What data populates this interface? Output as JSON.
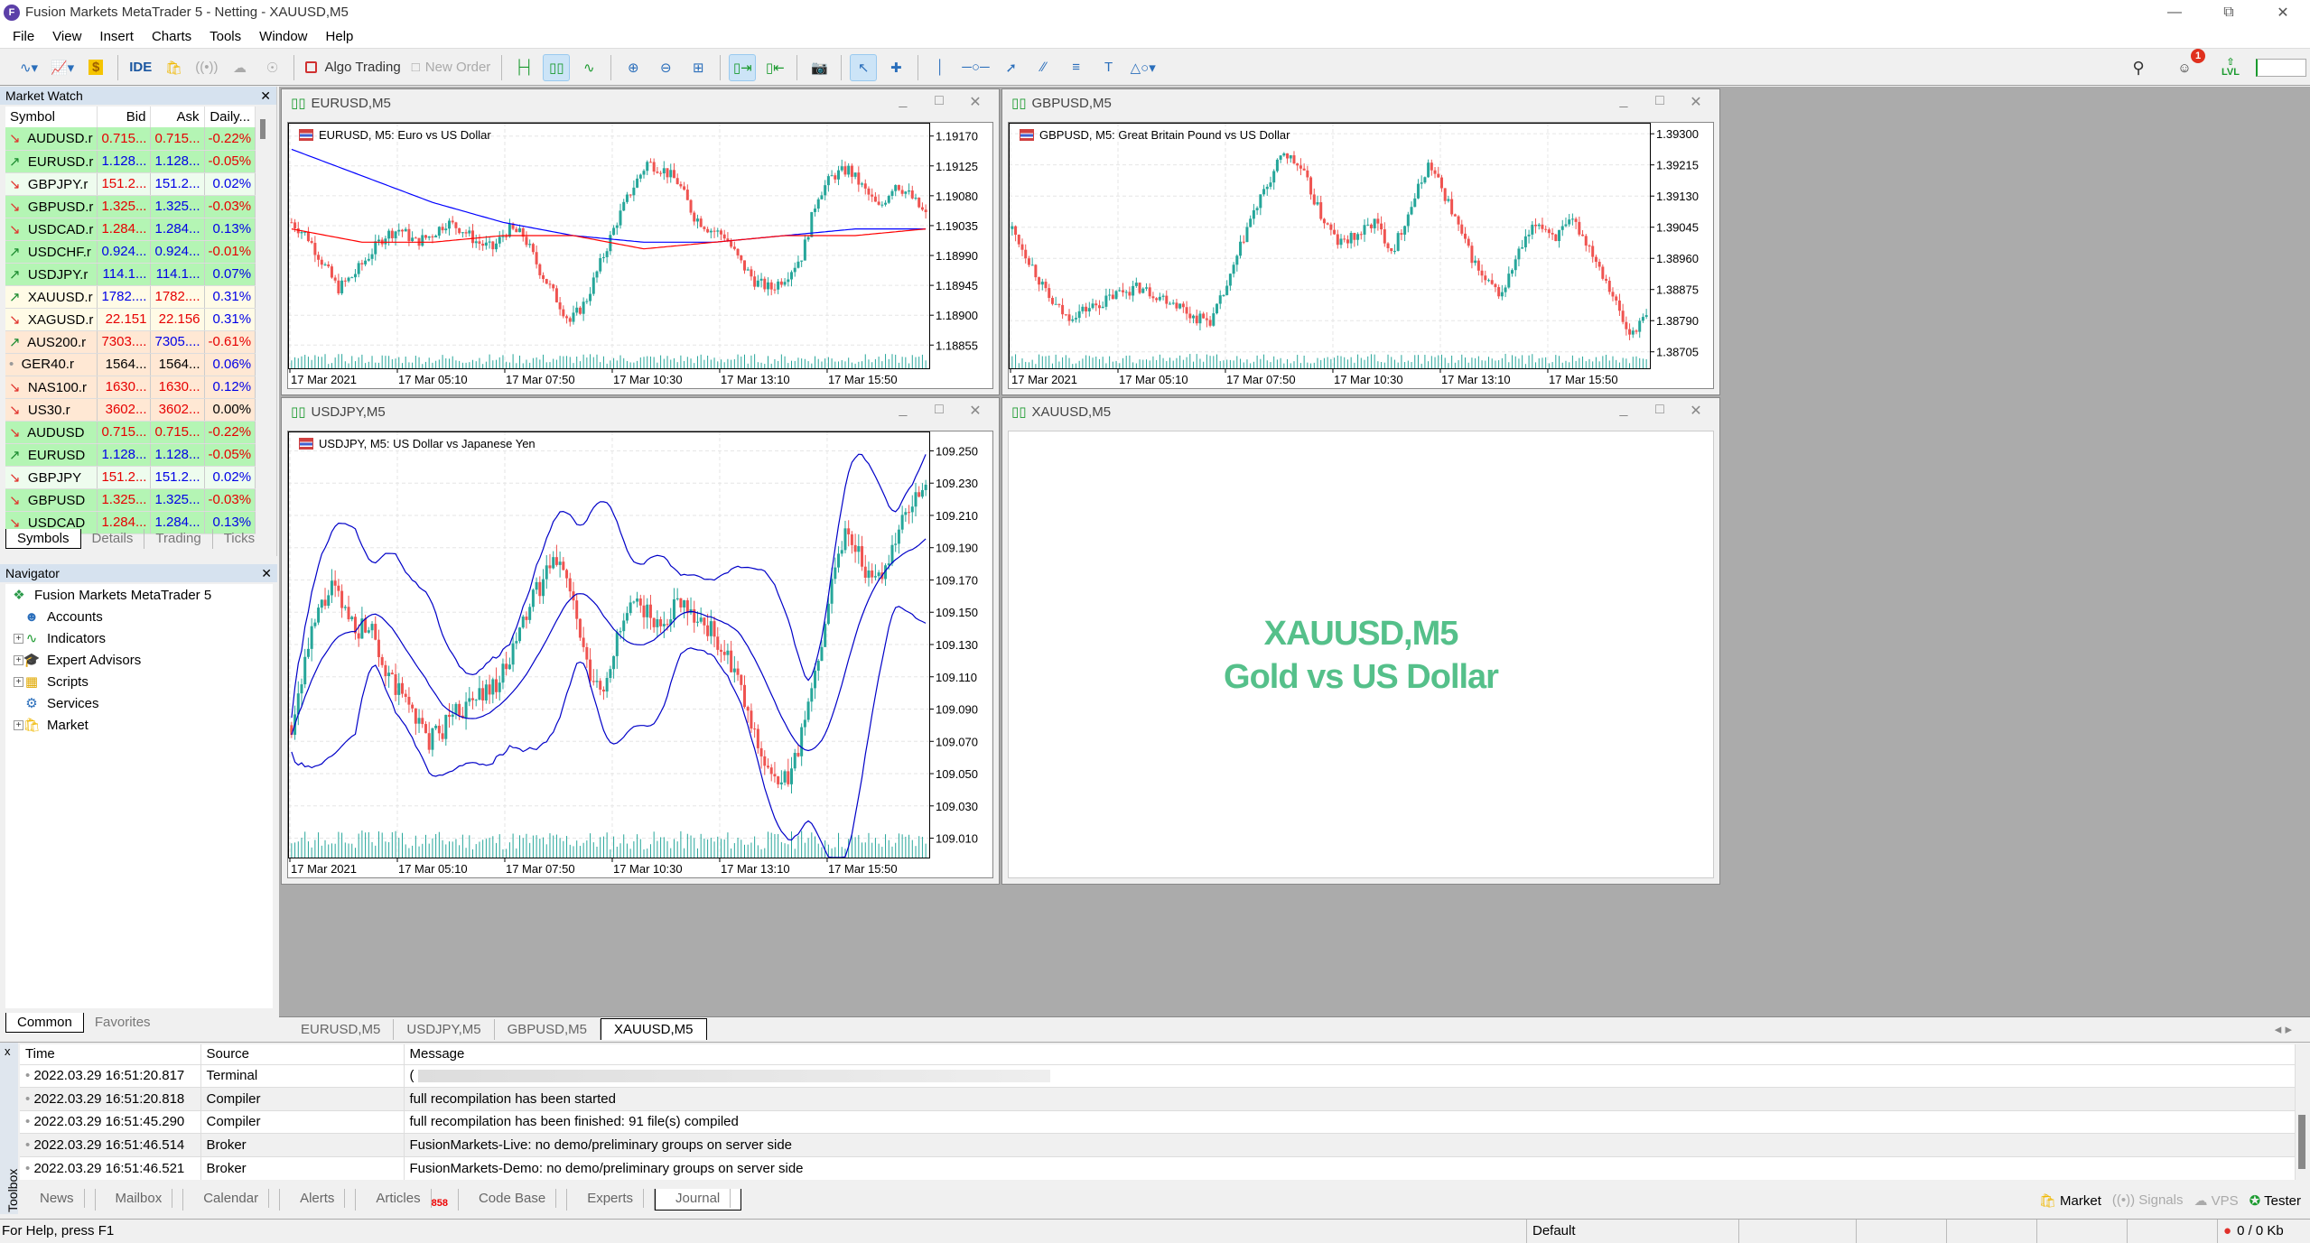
{
  "window": {
    "title": "Fusion Markets MetaTrader 5 - Netting - XAUUSD,M5",
    "controls": [
      "minimize",
      "restore",
      "close"
    ]
  },
  "menu": [
    "File",
    "View",
    "Insert",
    "Charts",
    "Tools",
    "Window",
    "Help"
  ],
  "toolbar": {
    "ide_label": "IDE",
    "algo_trading_label": "Algo Trading",
    "new_order_label": "New Order",
    "notification_count": "1",
    "level_label": "LVL",
    "icons": [
      "new-chart-icon",
      "profiles-icon",
      "dollar-icon",
      "ide-icon",
      "market-icon",
      "signals-icon",
      "vps-icon",
      "tester-icon",
      "algo-trading-icon",
      "new-order-icon",
      "bar-chart-icon",
      "candlestick-icon",
      "line-chart-icon",
      "zoom-in-icon",
      "zoom-out-icon",
      "tile-icon",
      "autoscroll-icon",
      "chart-shift-icon",
      "screenshot-icon",
      "cursor-icon",
      "crosshair-icon",
      "vertical-line-icon",
      "horizontal-line-icon",
      "trendline-icon",
      "equidistant-channel-icon",
      "fibonacci-icon",
      "text-icon",
      "shapes-icon",
      "search-icon",
      "account-icon",
      "level-icon"
    ]
  },
  "market_watch": {
    "title": "Market Watch",
    "columns": [
      "Symbol",
      "Bid",
      "Ask",
      "Daily..."
    ],
    "rows": [
      {
        "dir": "down",
        "symbol": "AUDUSD.r",
        "bid": "0.715...",
        "ask": "0.715...",
        "daily": "-0.22%",
        "bid_c": "red",
        "ask_c": "red",
        "daily_c": "red",
        "bg": "#b4f5b4"
      },
      {
        "dir": "up",
        "symbol": "EURUSD.r",
        "bid": "1.128...",
        "ask": "1.128...",
        "daily": "-0.05%",
        "bid_c": "blue",
        "ask_c": "blue",
        "daily_c": "red",
        "bg": "#b4f5b4"
      },
      {
        "dir": "down",
        "symbol": "GBPJPY.r",
        "bid": "151.2...",
        "ask": "151.2...",
        "daily": "0.02%",
        "bid_c": "red",
        "ask_c": "blue",
        "daily_c": "blue",
        "bg": "#eefcee"
      },
      {
        "dir": "down",
        "symbol": "GBPUSD.r",
        "bid": "1.325...",
        "ask": "1.325...",
        "daily": "-0.03%",
        "bid_c": "red",
        "ask_c": "blue",
        "daily_c": "red",
        "bg": "#b4f5b4"
      },
      {
        "dir": "down",
        "symbol": "USDCAD.r",
        "bid": "1.284...",
        "ask": "1.284...",
        "daily": "0.13%",
        "bid_c": "red",
        "ask_c": "blue",
        "daily_c": "blue",
        "bg": "#b4f5b4"
      },
      {
        "dir": "up",
        "symbol": "USDCHF.r",
        "bid": "0.924...",
        "ask": "0.924...",
        "daily": "-0.01%",
        "bid_c": "blue",
        "ask_c": "blue",
        "daily_c": "red",
        "bg": "#b4f5b4"
      },
      {
        "dir": "up",
        "symbol": "USDJPY.r",
        "bid": "114.1...",
        "ask": "114.1...",
        "daily": "0.07%",
        "bid_c": "blue",
        "ask_c": "blue",
        "daily_c": "blue",
        "bg": "#b4f5b4"
      },
      {
        "dir": "up",
        "symbol": "XAUUSD.r",
        "bid": "1782....",
        "ask": "1782....",
        "daily": "0.31%",
        "bid_c": "blue",
        "ask_c": "red",
        "daily_c": "blue",
        "bg": "#fffbe6"
      },
      {
        "dir": "down",
        "symbol": "XAGUSD.r",
        "bid": "22.151",
        "ask": "22.156",
        "daily": "0.31%",
        "bid_c": "red",
        "ask_c": "red",
        "daily_c": "blue",
        "bg": "#fffbe6"
      },
      {
        "dir": "up",
        "symbol": "AUS200.r",
        "bid": "7303....",
        "ask": "7305....",
        "daily": "-0.61%",
        "bid_c": "red",
        "ask_c": "blue",
        "daily_c": "red",
        "bg": "#ffe8d4"
      },
      {
        "dir": "none",
        "symbol": "GER40.r",
        "bid": "1564...",
        "ask": "1564...",
        "daily": "0.06%",
        "bid_c": "blk",
        "ask_c": "blk",
        "daily_c": "blue",
        "bg": "#ffe8d4"
      },
      {
        "dir": "down",
        "symbol": "NAS100.r",
        "bid": "1630...",
        "ask": "1630...",
        "daily": "0.12%",
        "bid_c": "red",
        "ask_c": "red",
        "daily_c": "blue",
        "bg": "#ffe8d4"
      },
      {
        "dir": "down",
        "symbol": "US30.r",
        "bid": "3602...",
        "ask": "3602...",
        "daily": "0.00%",
        "bid_c": "red",
        "ask_c": "red",
        "daily_c": "blk",
        "bg": "#ffe8d4"
      },
      {
        "dir": "down",
        "symbol": "AUDUSD",
        "bid": "0.715...",
        "ask": "0.715...",
        "daily": "-0.22%",
        "bid_c": "red",
        "ask_c": "red",
        "daily_c": "red",
        "bg": "#b4f5b4"
      },
      {
        "dir": "up",
        "symbol": "EURUSD",
        "bid": "1.128...",
        "ask": "1.128...",
        "daily": "-0.05%",
        "bid_c": "blue",
        "ask_c": "blue",
        "daily_c": "red",
        "bg": "#b4f5b4"
      },
      {
        "dir": "down",
        "symbol": "GBPJPY",
        "bid": "151.2...",
        "ask": "151.2...",
        "daily": "0.02%",
        "bid_c": "red",
        "ask_c": "blue",
        "daily_c": "blue",
        "bg": "#eefcee"
      },
      {
        "dir": "down",
        "symbol": "GBPUSD",
        "bid": "1.325...",
        "ask": "1.325...",
        "daily": "-0.03%",
        "bid_c": "red",
        "ask_c": "blue",
        "daily_c": "red",
        "bg": "#b4f5b4"
      },
      {
        "dir": "down",
        "symbol": "USDCAD",
        "bid": "1.284...",
        "ask": "1.284...",
        "daily": "0.13%",
        "bid_c": "red",
        "ask_c": "blue",
        "daily_c": "blue",
        "bg": "#b4f5b4"
      }
    ],
    "tabs": [
      "Symbols",
      "Details",
      "Trading",
      "Ticks"
    ],
    "selected_tab": "Symbols"
  },
  "navigator": {
    "title": "Navigator",
    "root": "Fusion Markets MetaTrader 5",
    "items": [
      {
        "label": "Accounts",
        "icon": "accounts-icon",
        "expandable": false
      },
      {
        "label": "Indicators",
        "icon": "indicators-icon",
        "expandable": true
      },
      {
        "label": "Expert Advisors",
        "icon": "expert-advisors-icon",
        "expandable": true
      },
      {
        "label": "Scripts",
        "icon": "scripts-icon",
        "expandable": true
      },
      {
        "label": "Services",
        "icon": "services-icon",
        "expandable": false
      },
      {
        "label": "Market",
        "icon": "market-icon",
        "expandable": true
      }
    ],
    "tabs": [
      "Common",
      "Favorites"
    ],
    "selected_tab": "Common"
  },
  "charts": {
    "eurusd": {
      "window_title": "EURUSD,M5",
      "label": "EURUSD, M5:  Euro vs US Dollar"
    },
    "gbpusd": {
      "window_title": "GBPUSD,M5",
      "label": "GBPUSD, M5:  Great Britain Pound vs US Dollar"
    },
    "usdjpy": {
      "window_title": "USDJPY,M5",
      "label": "USDJPY, M5:  US Dollar vs Japanese Yen"
    },
    "xauusd": {
      "window_title": "XAUUSD,M5",
      "placeholder_line1": "XAUUSD,M5",
      "placeholder_line2": "Gold vs US Dollar"
    }
  },
  "chart_data": [
    {
      "type": "candlestick",
      "title": "EURUSD, M5: Euro vs US Dollar",
      "x_ticks": [
        "17 Mar 2021",
        "17 Mar 05:10",
        "17 Mar 07:50",
        "17 Mar 10:30",
        "17 Mar 13:10",
        "17 Mar 15:50"
      ],
      "y_ticks": [
        "1.19170",
        "1.19125",
        "1.19080",
        "1.19035",
        "1.18990",
        "1.18945",
        "1.18900",
        "1.18855"
      ],
      "ylim": [
        1.1882,
        1.1919
      ],
      "closes": [
        1.1904,
        1.1902,
        1.1898,
        1.1894,
        1.1896,
        1.1899,
        1.1902,
        1.1903,
        1.1901,
        1.1902,
        1.1904,
        1.1903,
        1.1901,
        1.19,
        1.1903,
        1.1902,
        1.1897,
        1.1893,
        1.1889,
        1.1892,
        1.1898,
        1.1904,
        1.1909,
        1.1913,
        1.1912,
        1.191,
        1.1905,
        1.1903,
        1.1902,
        1.1898,
        1.1895,
        1.1894,
        1.1896,
        1.1899,
        1.1908,
        1.1911,
        1.1912,
        1.1909,
        1.1906,
        1.191,
        1.1908,
        1.1905
      ],
      "series": [
        {
          "name": "MA slow",
          "color": "#0000ff",
          "values": [
            1.1915,
            1.1911,
            1.1907,
            1.1904,
            1.1902,
            1.1901,
            1.1901,
            1.1902,
            1.1903,
            1.1903
          ]
        },
        {
          "name": "MA fast",
          "color": "#ff0000",
          "values": [
            1.1903,
            1.1901,
            1.1901,
            1.1902,
            1.1902,
            1.19,
            1.1901,
            1.1902,
            1.1902,
            1.1903
          ]
        }
      ]
    },
    {
      "type": "candlestick",
      "title": "GBPUSD, M5: Great Britain Pound vs US Dollar",
      "x_ticks": [
        "17 Mar 2021",
        "17 Mar 05:10",
        "17 Mar 07:50",
        "17 Mar 10:30",
        "17 Mar 13:10",
        "17 Mar 15:50"
      ],
      "y_ticks": [
        "1.39300",
        "1.39215",
        "1.39130",
        "1.39045",
        "1.38960",
        "1.38875",
        "1.38790",
        "1.38705"
      ],
      "ylim": [
        1.3866,
        1.3933
      ],
      "closes": [
        1.3904,
        1.3895,
        1.3885,
        1.388,
        1.3882,
        1.3884,
        1.3887,
        1.3888,
        1.3886,
        1.3884,
        1.388,
        1.3879,
        1.389,
        1.3905,
        1.3915,
        1.3925,
        1.392,
        1.3908,
        1.39,
        1.3902,
        1.3906,
        1.3898,
        1.391,
        1.3922,
        1.3912,
        1.39,
        1.389,
        1.3886,
        1.3898,
        1.3906,
        1.3902,
        1.3906,
        1.3898,
        1.3888,
        1.3875,
        1.388
      ]
    },
    {
      "type": "candlestick",
      "title": "USDJPY, M5: US Dollar vs Japanese Yen",
      "x_ticks": [
        "17 Mar 2021",
        "17 Mar 05:10",
        "17 Mar 07:50",
        "17 Mar 10:30",
        "17 Mar 13:10",
        "17 Mar 15:50"
      ],
      "y_ticks": [
        "109.250",
        "109.230",
        "109.210",
        "109.190",
        "109.170",
        "109.150",
        "109.130",
        "109.110",
        "109.090",
        "109.070",
        "109.050",
        "109.030",
        "109.010"
      ],
      "ylim": [
        108.998,
        109.262
      ],
      "closes": [
        109.08,
        109.12,
        109.15,
        109.165,
        109.15,
        109.14,
        109.145,
        109.11,
        109.1,
        109.09,
        109.07,
        109.075,
        109.09,
        109.09,
        109.1,
        109.105,
        109.115,
        109.14,
        109.16,
        109.175,
        109.185,
        109.15,
        109.11,
        109.1,
        109.13,
        109.15,
        109.155,
        109.14,
        109.15,
        109.16,
        109.145,
        109.14,
        109.125,
        109.11,
        109.08,
        109.06,
        109.04,
        109.05,
        109.08,
        109.12,
        109.17,
        109.2,
        109.19,
        109.165,
        109.18,
        109.2,
        109.22,
        109.225
      ],
      "series": [
        {
          "name": "Bollinger Bands",
          "color": "#0000c8"
        }
      ]
    }
  ],
  "chart_tabs": [
    "EURUSD,M5",
    "USDJPY,M5",
    "GBPUSD,M5",
    "XAUUSD,M5"
  ],
  "selected_chart_tab": "XAUUSD,M5",
  "toolbox": {
    "side_label": "Toolbox",
    "columns": [
      "Time",
      "Source",
      "Message"
    ],
    "rows": [
      {
        "time": "2022.03.29 16:51:20.817",
        "source": "Terminal",
        "message": "("
      },
      {
        "time": "2022.03.29 16:51:20.818",
        "source": "Compiler",
        "message": "full recompilation has been started"
      },
      {
        "time": "2022.03.29 16:51:45.290",
        "source": "Compiler",
        "message": "full recompilation has been finished:  91 file(s) compiled"
      },
      {
        "time": "2022.03.29 16:51:46.514",
        "source": "Broker",
        "message": "FusionMarkets-Live: no demo/preliminary groups on server side"
      },
      {
        "time": "2022.03.29 16:51:46.521",
        "source": "Broker",
        "message": "FusionMarkets-Demo: no demo/preliminary groups on server side"
      }
    ],
    "tabs": [
      "News",
      "Mailbox",
      "Calendar",
      "Alerts",
      "Articles",
      "Code Base",
      "Experts",
      "Journal"
    ],
    "articles_badge": "858",
    "selected_tab": "Journal",
    "right_links": [
      {
        "label": "Market",
        "enabled": true
      },
      {
        "label": "Signals",
        "enabled": false
      },
      {
        "label": "VPS",
        "enabled": false
      },
      {
        "label": "Tester",
        "enabled": true
      }
    ]
  },
  "statusbar": {
    "help": "For Help, press F1",
    "profile": "Default",
    "traffic": "0 / 0 Kb"
  },
  "colors": {
    "bull": "#26a69a",
    "bear": "#ef5350",
    "volume": "#26a69a",
    "xau_text": "#55c08a"
  }
}
